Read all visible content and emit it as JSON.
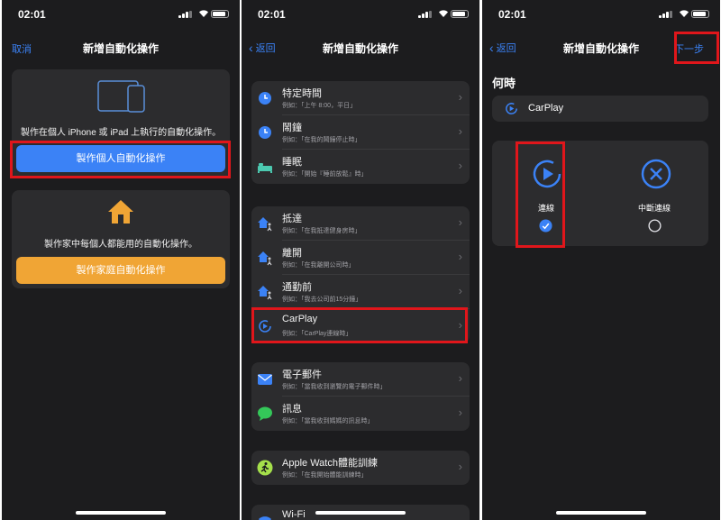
{
  "status": {
    "time": "02:01"
  },
  "screen1": {
    "nav": {
      "left": "取消",
      "title": "新增自動化操作"
    },
    "personal": {
      "caption": "製作在個人 iPhone 或 iPad 上執行的自動化操作。",
      "button": "製作個人自動化操作"
    },
    "home": {
      "caption": "製作家中每個人都能用的自動化操作。",
      "button": "製作家庭自動化操作"
    }
  },
  "screen2": {
    "nav": {
      "back": "返回",
      "title": "新增自動化操作"
    },
    "groups": [
      {
        "items": [
          {
            "title": "特定時間",
            "sub": "例如：「上午 8:00，平日」",
            "icon": "clock-icon"
          },
          {
            "title": "鬧鐘",
            "sub": "例如：「在我的鬧鐘停止時」",
            "icon": "alarm-icon"
          },
          {
            "title": "睡眠",
            "sub": "例如：「開始『睡前放鬆』時」",
            "icon": "bed-icon"
          }
        ]
      },
      {
        "items": [
          {
            "title": "抵達",
            "sub": "例如：「在我抵達健身房時」",
            "icon": "arrive-icon"
          },
          {
            "title": "離開",
            "sub": "例如：「在我離開公司時」",
            "icon": "leave-icon"
          },
          {
            "title": "通勤前",
            "sub": "例如：「我去公司前15分鐘」",
            "icon": "commute-icon"
          },
          {
            "title": "CarPlay",
            "sub": "例如：「CarPlay連線時」",
            "icon": "carplay-icon"
          }
        ]
      },
      {
        "items": [
          {
            "title": "電子郵件",
            "sub": "例如：「當我收到瀏覽的電子郵件時」",
            "icon": "mail-icon"
          },
          {
            "title": "訊息",
            "sub": "例如：「當我收到媽媽的訊息時」",
            "icon": "message-icon"
          }
        ]
      },
      {
        "items": [
          {
            "title": "Apple Watch體能訓練",
            "sub": "例如：「在我開始體能訓練時」",
            "icon": "workout-icon"
          }
        ]
      },
      {
        "items": [
          {
            "title": "Wi-Fi",
            "sub": "",
            "icon": "wifi-icon"
          }
        ]
      }
    ]
  },
  "screen3": {
    "nav": {
      "back": "返回",
      "title": "新增自動化操作",
      "next": "下一步"
    },
    "when": "何時",
    "trigger": "CarPlay",
    "options": [
      {
        "label": "連線",
        "selected": true
      },
      {
        "label": "中斷連線",
        "selected": false
      }
    ]
  },
  "colors": {
    "accent": "#3b82f6",
    "orange": "#f0a535",
    "highlight": "#e0161b"
  }
}
